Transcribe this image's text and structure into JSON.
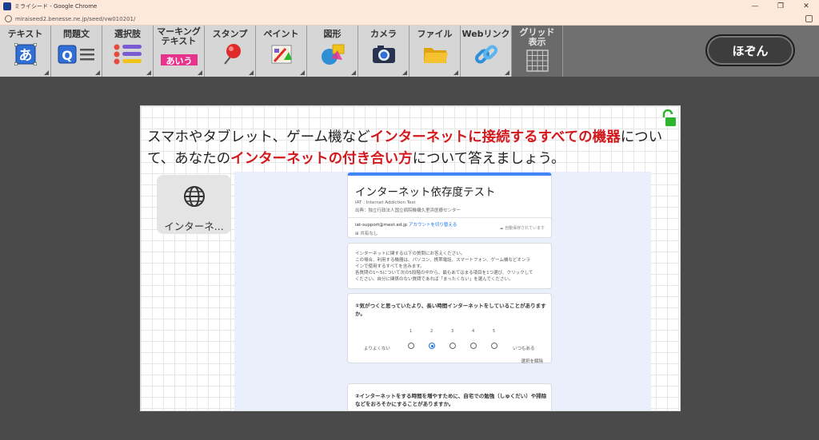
{
  "window": {
    "title": "ミライシード - Google Chrome",
    "url": "miraiseed2.benesse.ne.jp/seed/vw010201/"
  },
  "toolbar": {
    "tools": [
      {
        "label": "テキスト",
        "icon": "text-icon"
      },
      {
        "label": "問題文",
        "icon": "question-icon"
      },
      {
        "label": "選択肢",
        "icon": "list-icon"
      },
      {
        "label": "マーキング\nテキスト",
        "icon": "marking-icon"
      },
      {
        "label": "スタンプ",
        "icon": "pin-icon"
      },
      {
        "label": "ペイント",
        "icon": "paint-icon"
      },
      {
        "label": "図形",
        "icon": "shapes-icon"
      },
      {
        "label": "カメラ",
        "icon": "camera-icon"
      },
      {
        "label": "ファイル",
        "icon": "folder-icon"
      },
      {
        "label": "Webリンク",
        "icon": "link-icon"
      },
      {
        "label": "グリッド\n表示",
        "icon": "grid-icon"
      }
    ],
    "text_icon_char": "あ",
    "question_icon_char": "Q",
    "marking_icon_text": "あいう",
    "save_label": "ほぞん"
  },
  "card": {
    "question_parts": [
      {
        "text": "スマホやタブレット、ゲーム機など",
        "hl": false
      },
      {
        "text": "インターネットに接続するすべての機器",
        "hl": true
      },
      {
        "text": "について、あなたの",
        "hl": false
      },
      {
        "text": "インターネットの付き合い方",
        "hl": true
      },
      {
        "text": "について答えましょう。",
        "hl": false
      }
    ],
    "link_label": "インターネ...",
    "form": {
      "title": "インターネット依存度テスト",
      "subtitle1": "IAT : Internet Addiction Test",
      "subtitle2": "出典：独立行政法人国立病院機構久里浜医療センター",
      "email": "iat-support@mext.ed.jp",
      "switch_account": "アカウントを切り替える",
      "not_shared": "共有なし",
      "saved_status": "自動保存されています",
      "intro_lines": [
        "インターネットに関する以下の質問にお答えください。",
        "この場合、利用する機器は、パソコン、携帯電話、スマートフォン、ゲーム機などオンラ",
        "インで使用するすべてを含みます。",
        "各質問の1〜5について次の5段階の中から、最もあてはまる項目を1つ選び、クリックして",
        "ください。自分に関係のない質問であれば「まったくない」を選んでください。"
      ],
      "q1_title": "①気がつくと思っていたより、長い時間インターネットをしていることがありますか。",
      "scale": [
        "1",
        "2",
        "3",
        "4",
        "5"
      ],
      "scale_min": "よりよくない",
      "scale_max": "いつもある",
      "selected": 2,
      "clear_selection": "選択を解除",
      "q2_title": "②インターネットをする時間を増やすために、自宅での勉強（しゅくだい）や掃除などをおろそかにすることがありますか。"
    }
  },
  "colors": {
    "highlight": "#d3191d",
    "toolbar_bg": "#d6d6d6",
    "accent": "#1a73e8",
    "lock": "#2db52d"
  }
}
